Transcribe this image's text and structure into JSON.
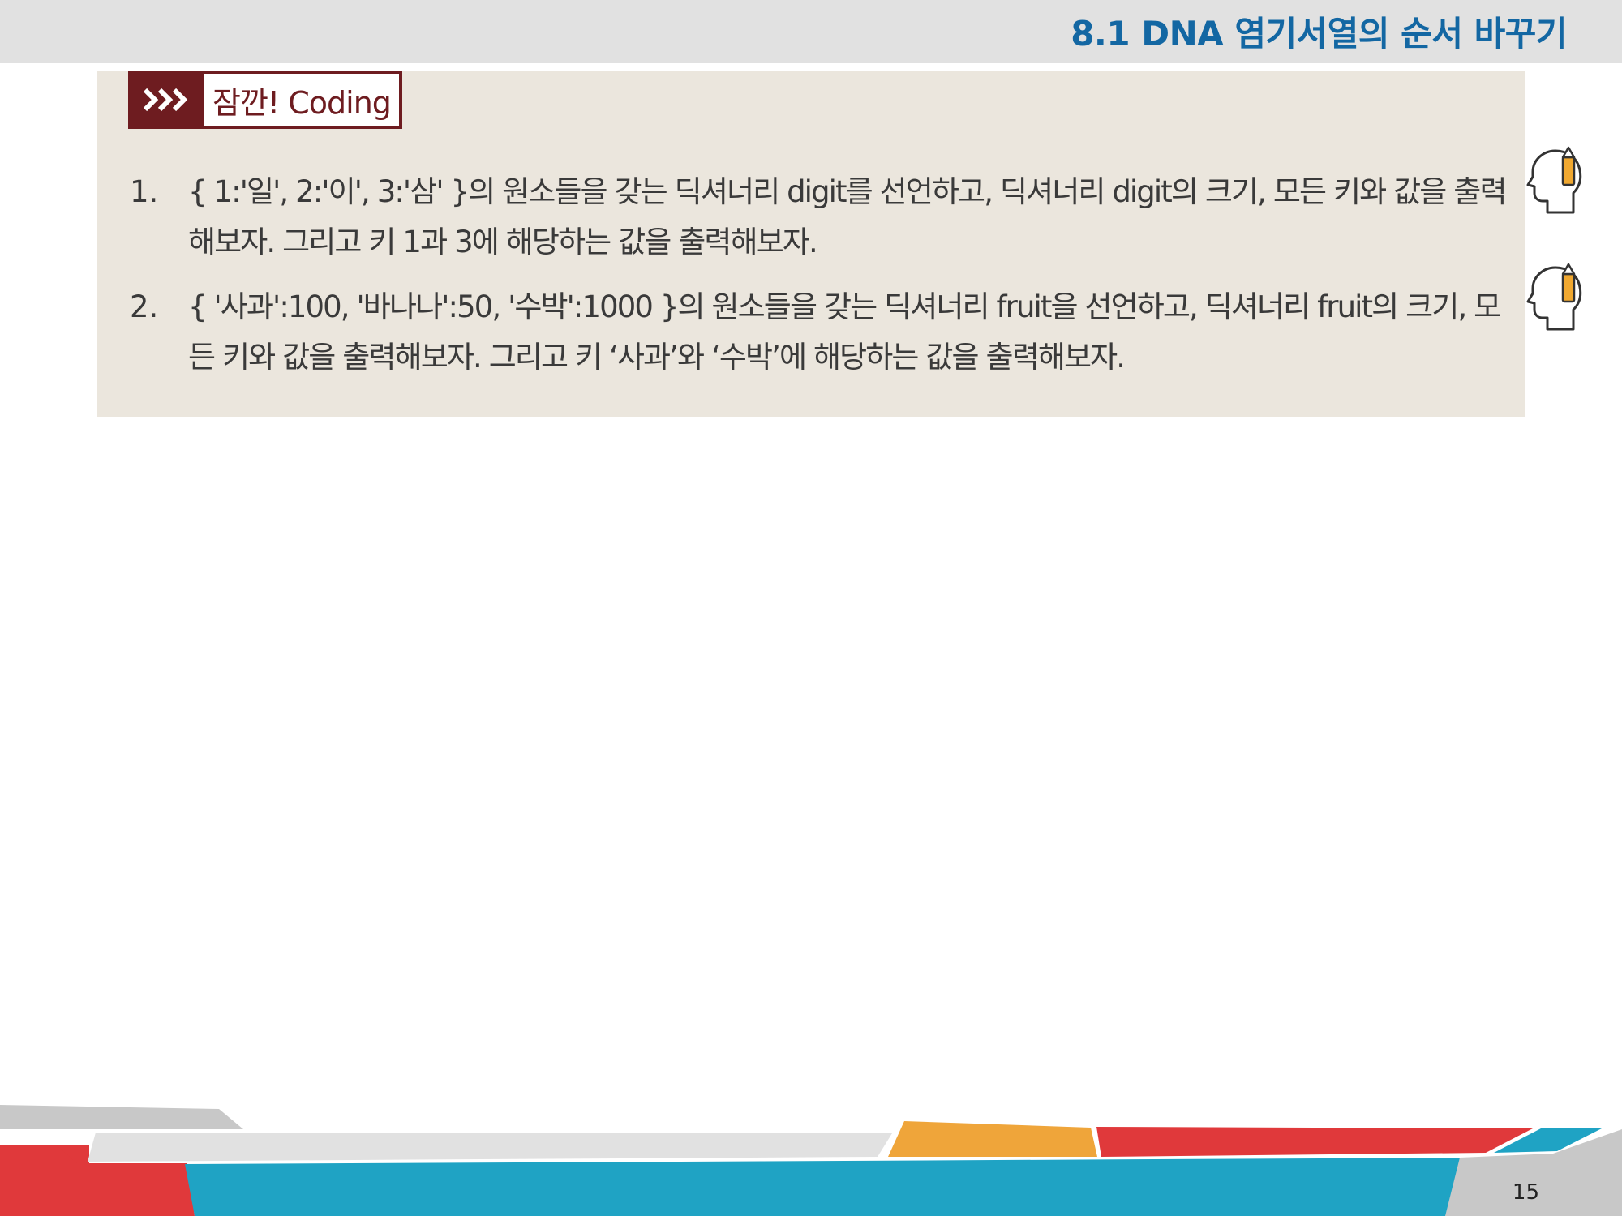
{
  "slide": {
    "title": "8.1 DNA 염기서열의 순서 바꾸기",
    "page_number": "15"
  },
  "coding_box": {
    "badge_label": "잠깐! Coding",
    "badge_icon": "triple-chevron-icon",
    "exercises": [
      {
        "number": "1.",
        "text": "{ 1:'일', 2:'이', 3:'삼' }의 원소들을 갖는 딕셔너리 digit를 선언하고, 딕셔너리 digit의 크기, 모든 키와 값을 출력해보자. 그리고 키 1과 3에 해당하는 값을 출력해보자.",
        "icon": "head-pencil-icon"
      },
      {
        "number": "2.",
        "text": "{ '사과':100, '바나나':50, '수박':1000 }의 원소들을 갖는 딕셔너리 fruit을 선언하고, 딕셔너리 fruit의 크기, 모든 키와 값을 출력해보자. 그리고 키 ‘사과’와 ‘수박’에 해당하는 값을 출력해보자.",
        "icon": "head-pencil-icon"
      }
    ]
  },
  "colors": {
    "header_bg": "#e1e1e1",
    "title": "#1367a3",
    "box_bg": "#ebe6dd",
    "badge": "#6e1c20",
    "footer_red": "#e0393b",
    "footer_teal": "#1fa3c4",
    "footer_orange": "#efa53a",
    "footer_gray": "#c8c8c8",
    "footer_light_gray": "#e1e1e1"
  }
}
